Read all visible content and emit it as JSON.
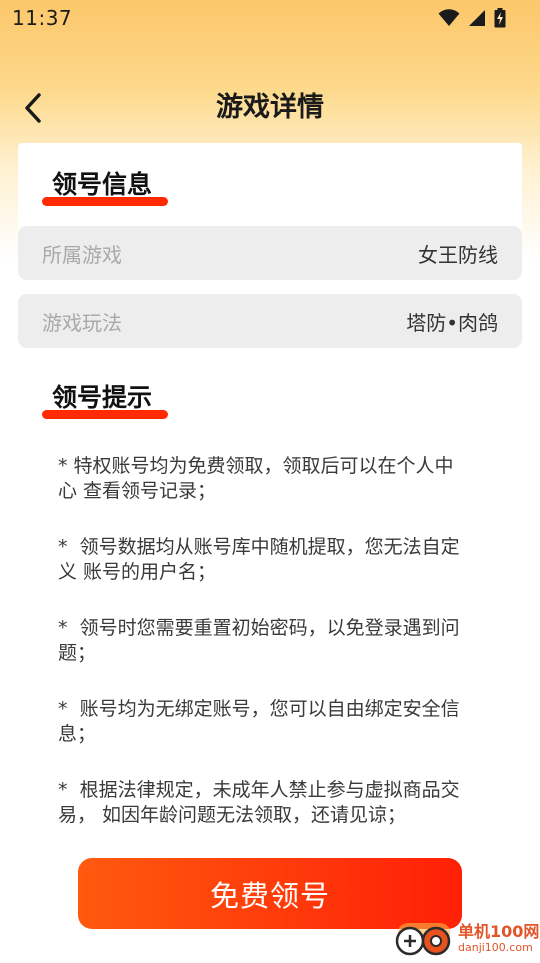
{
  "status_bar": {
    "time": "11:37",
    "icons": [
      "wifi-icon",
      "signal-icon",
      "battery-charging-icon"
    ]
  },
  "header": {
    "back_icon": "chevron-left-icon",
    "title": "游戏详情"
  },
  "account_info": {
    "section_title": "领号信息",
    "fields": [
      {
        "label": "所属游戏",
        "value": "女王防线"
      },
      {
        "label": "游戏玩法",
        "value": "塔防•肉鸽"
      }
    ]
  },
  "tips": {
    "section_title": "领号提示",
    "items": [
      "* 特权账号均为免费领取，领取后可以在个人中\n心 查看领号记录；",
      "*  领号数据均从账号库中随机提取，您无法自定\n义 账号的用户名；",
      "*  领号时您需要重置初始密码，以免登录遇到问\n题；",
      "*  账号均为无绑定账号，您可以自由绑定安全信\n息；",
      "*  根据法律规定，未成年人禁止参与虚拟商品交\n易， 如因年龄问题无法领取，还请见谅；"
    ]
  },
  "claim_button": {
    "label": "免费领号"
  },
  "watermark": {
    "name": "单机100网",
    "url": "danji100.com"
  },
  "colors": {
    "accent": "#ff3a0a",
    "underline": "#ff2a00",
    "header_gradient_top": "#fcc76a",
    "field_background": "#ededed"
  }
}
